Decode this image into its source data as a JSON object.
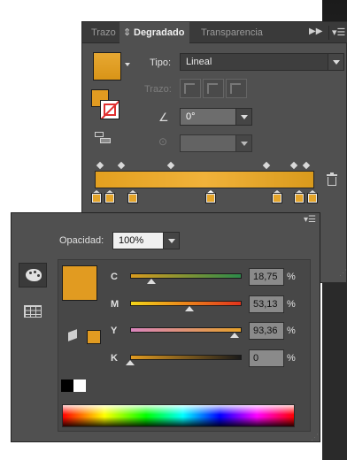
{
  "gradient_panel": {
    "tabs": [
      "Trazo",
      "Degradado",
      "Transparencia"
    ],
    "active_tab": "Degradado",
    "tipo_label": "Tipo:",
    "tipo_value": "Lineal",
    "trazo_label": "Trazo:",
    "angle_value": "0°"
  },
  "color_panel": {
    "opacity_label": "Opacidad:",
    "opacity_value": "100%",
    "channels": [
      {
        "label": "C",
        "value": "18,75",
        "unit": "%",
        "level": 0.1875
      },
      {
        "label": "M",
        "value": "53,13",
        "unit": "%",
        "level": 0.5313
      },
      {
        "label": "Y",
        "value": "93,36",
        "unit": "%",
        "level": 0.9336
      },
      {
        "label": "K",
        "value": "0",
        "unit": "%",
        "level": 0
      }
    ]
  },
  "colors": {
    "fill": "#e19b21",
    "panel_bg": "#505050"
  }
}
